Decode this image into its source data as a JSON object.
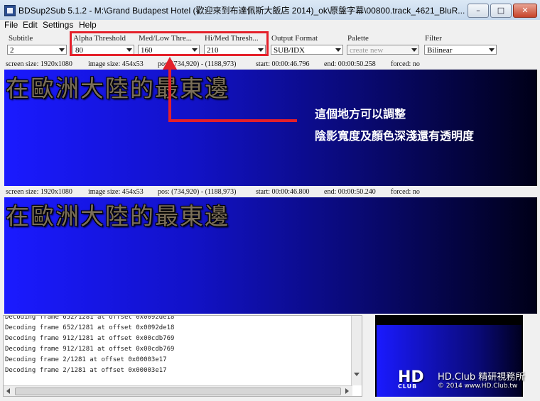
{
  "window": {
    "title": "BDSup2Sub 5.1.2 - M:\\Grand Budapest Hotel (歡迎來到布達佩斯大飯店 2014)_ok\\原盤字幕\\00800.track_4621_BluR...",
    "minimize": "–",
    "maximize": "□",
    "close": "✕"
  },
  "menu": [
    "File",
    "Edit",
    "Settings",
    "Help"
  ],
  "controls": {
    "subtitle": {
      "label": "Subtitle",
      "value": "2"
    },
    "alpha": {
      "label": "Alpha Threshold",
      "value": "80"
    },
    "medlow": {
      "label": "Med/Low Thre...",
      "value": "160"
    },
    "himed": {
      "label": "Hi/Med Thresh...",
      "value": "210"
    },
    "output": {
      "label": "Output Format",
      "value": "SUB/IDX"
    },
    "palette": {
      "label": "Palette",
      "value": "create new"
    },
    "filter": {
      "label": "Filter",
      "value": "Bilinear"
    }
  },
  "source_info": {
    "screen": "screen size: 1920x1080",
    "image": "image size: 454x53",
    "pos": "pos: (734,920) - (1188,973)",
    "start": "start: 00:00:46.796",
    "end": "end: 00:00:50.258",
    "forced": "forced: no"
  },
  "target_info": {
    "screen": "screen size: 1920x1080",
    "image": "image size: 454x53",
    "pos": "pos: (734,920) - (1188,973)",
    "start": "start: 00:00:46.800",
    "end": "end: 00:00:50.240",
    "forced": "forced: no"
  },
  "subtitle_text": "在歐洲大陸的最東邊",
  "annotation": {
    "line1": "這個地方可以調整",
    "line2": "陰影寬度及顏色深淺還有透明度"
  },
  "log_lines": [
    "Decoding frame 652/1281 at offset 0x0092de18",
    "Decoding frame 652/1281 at offset 0x0092de18",
    "Decoding frame 912/1281 at offset 0x00cdb769",
    "Decoding frame 912/1281 at offset 0x00cdb769",
    "Decoding frame 2/1281 at offset 0x00003e17",
    "Decoding frame 2/1281 at offset 0x00003e17"
  ],
  "watermark": {
    "logo": "HD",
    "logo_sub": "CLUB",
    "site": "HD.Club 精研視務所",
    "copy": "© 2014 www.HD.Club.tw"
  },
  "colors": {
    "annotation_red": "#e4202a",
    "video_blue": "#1a1aff"
  }
}
